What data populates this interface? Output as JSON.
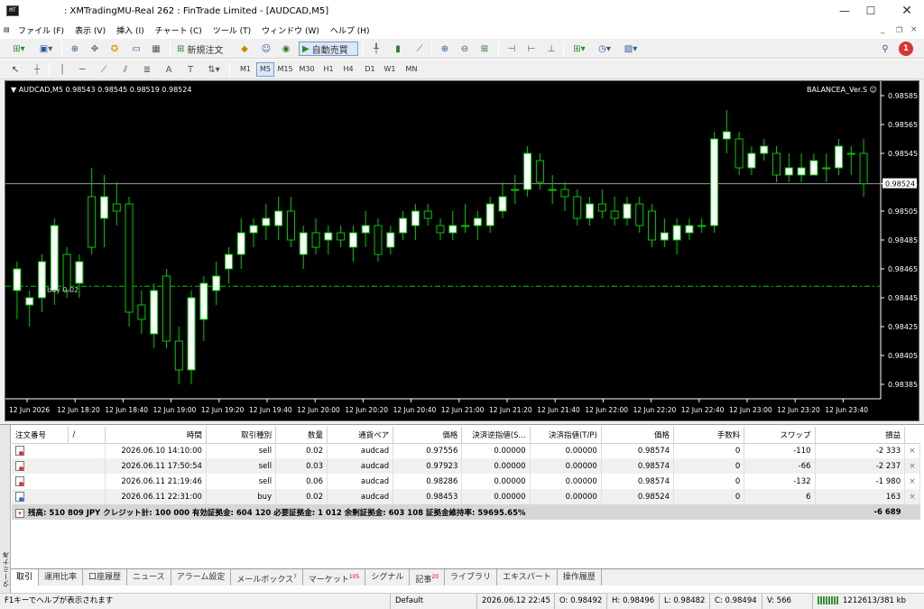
{
  "window": {
    "title": ": XMTradingMU-Real 262 : FinTrade Limited - [AUDCAD,M5]",
    "icon": "mt4-app-icon"
  },
  "menu": [
    "ファイル (F)",
    "表示 (V)",
    "挿入 (I)",
    "チャート (C)",
    "ツール (T)",
    "ウィンドウ (W)",
    "ヘルプ (H)"
  ],
  "toolbar": {
    "new_order": "新規注文",
    "auto_trade": "自動売買",
    "notification_count": "1"
  },
  "timeframes": [
    "M1",
    "M5",
    "M15",
    "M30",
    "H1",
    "H4",
    "D1",
    "W1",
    "MN"
  ],
  "active_timeframe": "M5",
  "chart": {
    "info": "▼ AUDCAD,M5  0.98543 0.98545 0.98519 0.98524",
    "ea_label": "BALANCEA_Ver.S ☺",
    "buy_label": "buy 0.02",
    "current_price": "0.98524",
    "price_labels": [
      "0.98585",
      "0.98565",
      "0.98545",
      "0.98524",
      "0.98505",
      "0.98485",
      "0.98465",
      "0.98445",
      "0.98425",
      "0.98405",
      "0.98385"
    ],
    "time_labels": [
      "12 Jun 2026",
      "12 Jun 18:20",
      "12 Jun 18:40",
      "12 Jun 19:00",
      "12 Jun 19:20",
      "12 Jun 19:40",
      "12 Jun 20:00",
      "12 Jun 20:20",
      "12 Jun 20:40",
      "12 Jun 21:00",
      "12 Jun 21:20",
      "12 Jun 21:40",
      "12 Jun 22:00",
      "12 Jun 22:20",
      "12 Jun 22:40",
      "12 Jun 23:00",
      "12 Jun 23:20",
      "12 Jun 23:40"
    ]
  },
  "chart_data": {
    "type": "candlestick",
    "symbol": "AUDCAD",
    "timeframe": "M5",
    "ylim": [
      0.98375,
      0.98595
    ],
    "current_price": 0.98524,
    "buy_line": 0.98453,
    "candles": [
      [
        0.9845,
        0.9847,
        0.9843,
        0.98465
      ],
      [
        0.9844,
        0.9845,
        0.98425,
        0.98445
      ],
      [
        0.98445,
        0.98475,
        0.98435,
        0.9847
      ],
      [
        0.9845,
        0.985,
        0.9844,
        0.98495
      ],
      [
        0.98475,
        0.9848,
        0.98445,
        0.9845
      ],
      [
        0.98455,
        0.98475,
        0.98445,
        0.9847
      ],
      [
        0.98515,
        0.98535,
        0.98475,
        0.9848
      ],
      [
        0.985,
        0.9853,
        0.9848,
        0.98515
      ],
      [
        0.9851,
        0.98525,
        0.98495,
        0.98505
      ],
      [
        0.9851,
        0.98515,
        0.98425,
        0.98435
      ],
      [
        0.9844,
        0.9845,
        0.9842,
        0.9843
      ],
      [
        0.9842,
        0.98455,
        0.9841,
        0.9845
      ],
      [
        0.9846,
        0.98465,
        0.9841,
        0.98415
      ],
      [
        0.98415,
        0.98425,
        0.98385,
        0.98395
      ],
      [
        0.98395,
        0.9845,
        0.98385,
        0.98445
      ],
      [
        0.9843,
        0.9846,
        0.98415,
        0.98455
      ],
      [
        0.9845,
        0.9847,
        0.9844,
        0.9846
      ],
      [
        0.98465,
        0.9848,
        0.98455,
        0.98475
      ],
      [
        0.98475,
        0.985,
        0.98465,
        0.9849
      ],
      [
        0.9849,
        0.985,
        0.9848,
        0.98495
      ],
      [
        0.98495,
        0.9851,
        0.98485,
        0.985
      ],
      [
        0.98495,
        0.98515,
        0.98485,
        0.98505
      ],
      [
        0.98505,
        0.98515,
        0.9848,
        0.98485
      ],
      [
        0.98475,
        0.98495,
        0.98465,
        0.9849
      ],
      [
        0.9849,
        0.985,
        0.98475,
        0.9848
      ],
      [
        0.98485,
        0.98495,
        0.98475,
        0.9849
      ],
      [
        0.9849,
        0.98495,
        0.9848,
        0.98485
      ],
      [
        0.9848,
        0.98495,
        0.9847,
        0.9849
      ],
      [
        0.9849,
        0.98505,
        0.9848,
        0.98495
      ],
      [
        0.98495,
        0.985,
        0.9847,
        0.98475
      ],
      [
        0.9848,
        0.98495,
        0.98475,
        0.9849
      ],
      [
        0.9849,
        0.98505,
        0.98485,
        0.985
      ],
      [
        0.98495,
        0.9851,
        0.98485,
        0.98505
      ],
      [
        0.98505,
        0.9851,
        0.98495,
        0.985
      ],
      [
        0.98495,
        0.985,
        0.98485,
        0.9849
      ],
      [
        0.9849,
        0.98505,
        0.98485,
        0.98495
      ],
      [
        0.98495,
        0.9851,
        0.9849,
        0.98495
      ],
      [
        0.98495,
        0.98505,
        0.98485,
        0.985
      ],
      [
        0.98495,
        0.98515,
        0.9849,
        0.9851
      ],
      [
        0.98505,
        0.98525,
        0.985,
        0.98515
      ],
      [
        0.9852,
        0.9853,
        0.9851,
        0.9852
      ],
      [
        0.9852,
        0.9855,
        0.98515,
        0.98545
      ],
      [
        0.9854,
        0.98545,
        0.9852,
        0.98525
      ],
      [
        0.9852,
        0.9853,
        0.9851,
        0.9852
      ],
      [
        0.9852,
        0.98525,
        0.98505,
        0.98515
      ],
      [
        0.98515,
        0.9852,
        0.98495,
        0.985
      ],
      [
        0.985,
        0.98515,
        0.98495,
        0.9851
      ],
      [
        0.9851,
        0.9852,
        0.985,
        0.98505
      ],
      [
        0.98505,
        0.98515,
        0.98495,
        0.985
      ],
      [
        0.985,
        0.98515,
        0.98495,
        0.9851
      ],
      [
        0.9851,
        0.98515,
        0.9849,
        0.98495
      ],
      [
        0.98505,
        0.9851,
        0.9848,
        0.98485
      ],
      [
        0.98485,
        0.985,
        0.9848,
        0.9849
      ],
      [
        0.98485,
        0.985,
        0.98475,
        0.98495
      ],
      [
        0.9849,
        0.985,
        0.98485,
        0.98495
      ],
      [
        0.98495,
        0.985,
        0.9849,
        0.98495
      ],
      [
        0.98495,
        0.9856,
        0.9849,
        0.98555
      ],
      [
        0.98555,
        0.98575,
        0.98545,
        0.9856
      ],
      [
        0.98555,
        0.9856,
        0.9853,
        0.98535
      ],
      [
        0.98535,
        0.9855,
        0.9853,
        0.98545
      ],
      [
        0.98545,
        0.98555,
        0.9854,
        0.9855
      ],
      [
        0.98545,
        0.9855,
        0.98525,
        0.9853
      ],
      [
        0.9853,
        0.98545,
        0.98525,
        0.98535
      ],
      [
        0.9853,
        0.98545,
        0.98525,
        0.98535
      ],
      [
        0.9853,
        0.98545,
        0.9853,
        0.9854
      ],
      [
        0.98535,
        0.98545,
        0.98525,
        0.98535
      ],
      [
        0.98535,
        0.98555,
        0.9853,
        0.9855
      ],
      [
        0.98545,
        0.9855,
        0.9853,
        0.98545
      ],
      [
        0.98545,
        0.98555,
        0.98515,
        0.98524
      ]
    ]
  },
  "table": {
    "headers": [
      "注文番号",
      "/",
      "時間",
      "取引種別",
      "数量",
      "通貨ペア",
      "価格",
      "決済逆指値(S...",
      "決済指値(T/P)",
      "価格",
      "手数料",
      "スワップ",
      "損益"
    ],
    "rows": [
      {
        "type": "sell",
        "time": "2026.06.10 14:10:00",
        "side": "sell",
        "lots": "0.02",
        "pair": "audcad",
        "price": "0.97556",
        "sl": "0.00000",
        "tp": "0.00000",
        "cur": "0.98574",
        "fee": "0",
        "swap": "-110",
        "pl": "-2 333"
      },
      {
        "type": "sell",
        "time": "2026.06.11 17:50:54",
        "side": "sell",
        "lots": "0.03",
        "pair": "audcad",
        "price": "0.97923",
        "sl": "0.00000",
        "tp": "0.00000",
        "cur": "0.98574",
        "fee": "0",
        "swap": "-66",
        "pl": "-2 237"
      },
      {
        "type": "sell",
        "time": "2026.06.11 21:19:46",
        "side": "sell",
        "lots": "0.06",
        "pair": "audcad",
        "price": "0.98286",
        "sl": "0.00000",
        "tp": "0.00000",
        "cur": "0.98574",
        "fee": "0",
        "swap": "-132",
        "pl": "-1 980"
      },
      {
        "type": "buy",
        "time": "2026.06.11 22:31:00",
        "side": "buy",
        "lots": "0.02",
        "pair": "audcad",
        "price": "0.98453",
        "sl": "0.00000",
        "tp": "0.00000",
        "cur": "0.98524",
        "fee": "0",
        "swap": "6",
        "pl": "163"
      }
    ],
    "summary": "残高: 510 809 JPY  クレジット計: 100 000  有効証拠金: 604 120  必要証拠金: 1 012  余剰証拠金: 603 108  証拠金維持率: 59695.65%",
    "summary_pl": "-6 689"
  },
  "side_label": "ターミナル",
  "tabs": [
    {
      "label": "取引",
      "badge": ""
    },
    {
      "label": "運用比率",
      "badge": ""
    },
    {
      "label": "口座履歴",
      "badge": ""
    },
    {
      "label": "ニュース",
      "badge": ""
    },
    {
      "label": "アラーム設定",
      "badge": ""
    },
    {
      "label": "メールボックス",
      "badge": "7"
    },
    {
      "label": "マーケット",
      "badge": "105"
    },
    {
      "label": "シグナル",
      "badge": ""
    },
    {
      "label": "記事",
      "badge": "20"
    },
    {
      "label": "ライブラリ",
      "badge": ""
    },
    {
      "label": "エキスパート",
      "badge": ""
    },
    {
      "label": "操作履歴",
      "badge": ""
    }
  ],
  "status": {
    "help": "F1キーでヘルプが表示されます",
    "profile": "Default",
    "datetime": "2026.06.12 22:45",
    "open": "O: 0.98492",
    "high": "H: 0.98496",
    "low": "L: 0.98482",
    "close": "C: 0.98494",
    "volume": "V: 566",
    "traffic": "1212613/381 kb"
  },
  "colors": {
    "bull": "#ffffff",
    "bear": "#000000",
    "wick": "#00c800",
    "buy_line": "#00c800",
    "chart_bg": "#000000"
  }
}
